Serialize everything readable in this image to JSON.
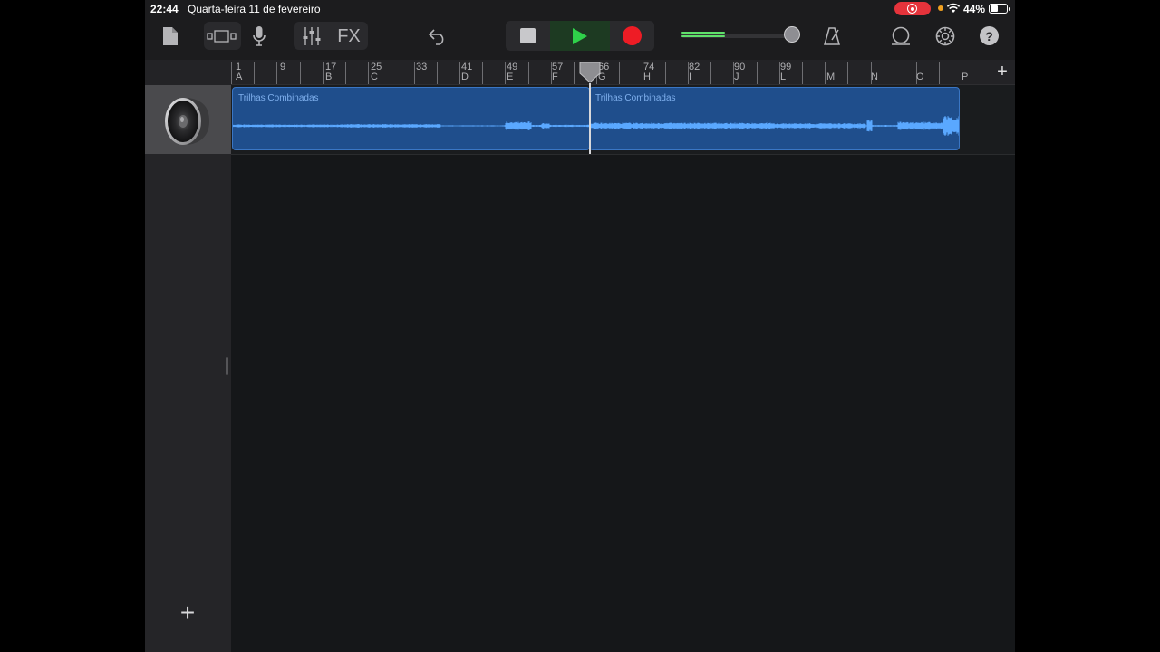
{
  "status_bar": {
    "time": "22:44",
    "date": "Quarta-feira 11 de fevereiro",
    "battery": "44%"
  },
  "toolbar": {
    "fx_label": "FX",
    "help_label": "?"
  },
  "volume": {
    "level": 0.38
  },
  "ruler": {
    "bars": [
      "1",
      "9",
      "17",
      "25",
      "33",
      "41",
      "49",
      "57",
      "66",
      "74",
      "82",
      "90",
      "99"
    ],
    "sections": [
      "A",
      "B",
      "C",
      "D",
      "E",
      "F",
      "G",
      "H",
      "I",
      "J",
      "L",
      "M",
      "N",
      "O",
      "P"
    ]
  },
  "tracks": [
    {
      "regions": [
        {
          "name": "Trilhas Combinadas"
        },
        {
          "name": "Trilhas Combinadas"
        }
      ]
    }
  ],
  "colors": {
    "region": "#1f4e8c",
    "waveform": "#5aa8ff",
    "play": "#2fd14a",
    "record": "#ee1c25"
  }
}
